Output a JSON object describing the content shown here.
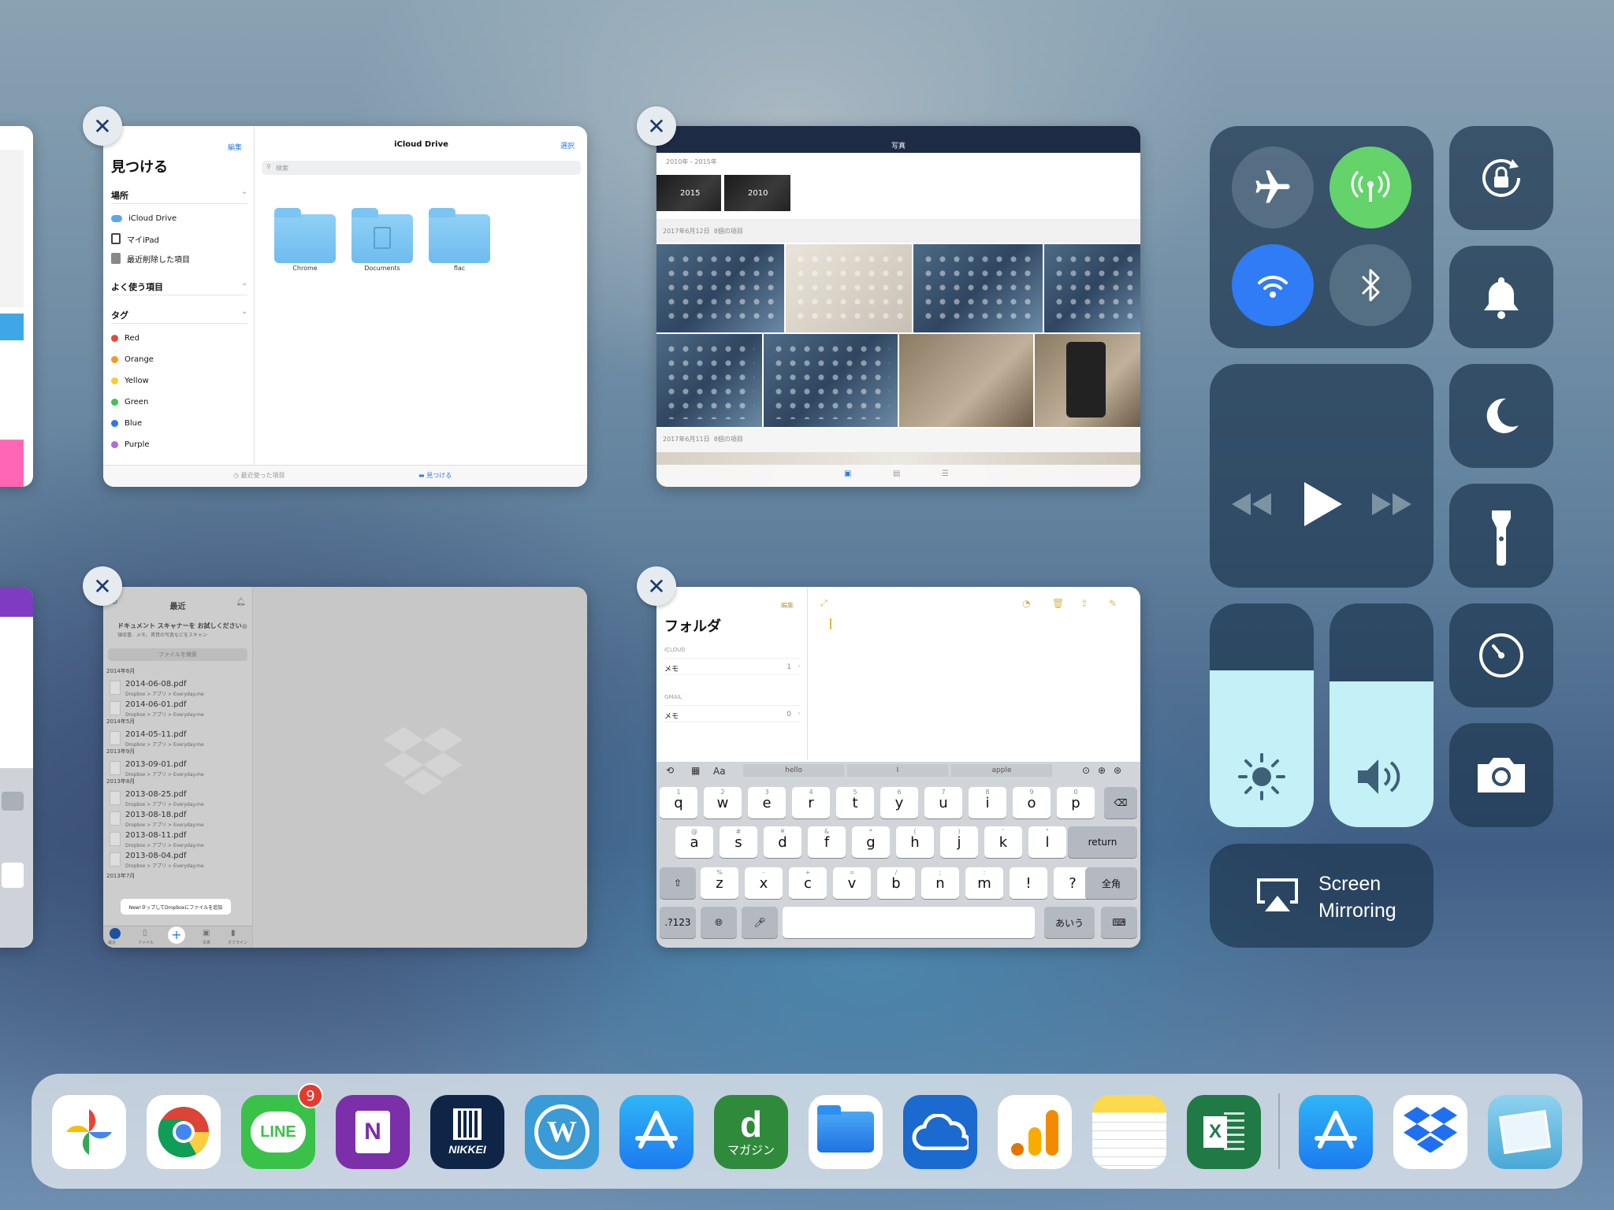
{
  "files_card": {
    "edit": "編集",
    "title": "見つける",
    "locations_header": "場所",
    "locations": [
      "iCloud Drive",
      "マイiPad",
      "最近削除した項目"
    ],
    "favorites_header": "よく使う項目",
    "tags_header": "タグ",
    "tags": [
      {
        "label": "Red",
        "color": "#e5463c"
      },
      {
        "label": "Orange",
        "color": "#f39a25"
      },
      {
        "label": "Yellow",
        "color": "#f7cd2f"
      },
      {
        "label": "Green",
        "color": "#46bf57"
      },
      {
        "label": "Blue",
        "color": "#2f7ae5"
      },
      {
        "label": "Purple",
        "color": "#b46ad9"
      }
    ],
    "main_title": "iCloud Drive",
    "select": "選択",
    "search_placeholder": "検索",
    "folders": [
      "Chrome",
      "Documents",
      "flac"
    ],
    "tab_recent": "最近使った項目",
    "tab_browse": "見つける"
  },
  "photos_card": {
    "title": "写真",
    "range": "2010年 - 2015年",
    "years": [
      "2015",
      "2010"
    ],
    "section1": "2017年6月12日",
    "section1_count": "8個の項目",
    "section2": "2017年6月11日",
    "section2_count": "8個の項目"
  },
  "dropbox_card": {
    "title": "最近",
    "banner_title": "ドキュメント スキャナーを お試しください",
    "banner_sub": "領収書、メモ、賃貸の写真などをスキャン",
    "search_placeholder": "ファイルを検索",
    "sections": [
      {
        "header": "2014年6月",
        "files": [
          "2014-06-08.pdf",
          "2014-06-01.pdf"
        ]
      },
      {
        "header": "2014年5月",
        "files": [
          "2014-05-11.pdf"
        ]
      },
      {
        "header": "2013年9月",
        "files": [
          "2013-09-01.pdf"
        ]
      },
      {
        "header": "2013年8月",
        "files": [
          "2013-08-25.pdf",
          "2013-08-18.pdf",
          "2013-08-11.pdf",
          "2013-08-04.pdf"
        ]
      }
    ],
    "file_sub": "Dropbox > アプリ > Everyday.me",
    "last_header": "2013年7月",
    "tooltip": "New!タップしてDropboxにファイルを追加",
    "tabs": [
      "最近",
      "ファイル",
      "写真",
      "オフライン"
    ]
  },
  "notes_card": {
    "edit": "編集",
    "title": "フォルダ",
    "icloud_header": "ICLOUD",
    "icloud_item": "メモ",
    "icloud_count": "1",
    "gmail_header": "GMAIL",
    "gmail_item": "メモ",
    "gmail_count": "0",
    "suggestions": [
      "hello",
      "I",
      "apple"
    ],
    "format_label": "Aa",
    "row1": [
      [
        "q",
        "1"
      ],
      [
        "w",
        "2"
      ],
      [
        "e",
        "3"
      ],
      [
        "r",
        "4"
      ],
      [
        "t",
        "5"
      ],
      [
        "y",
        "6"
      ],
      [
        "u",
        "7"
      ],
      [
        "i",
        "8"
      ],
      [
        "o",
        "9"
      ],
      [
        "p",
        "0"
      ]
    ],
    "row2": [
      [
        "a",
        "@"
      ],
      [
        "s",
        "#"
      ],
      [
        "d",
        "¥"
      ],
      [
        "f",
        "&"
      ],
      [
        "g",
        "*"
      ],
      [
        "h",
        "("
      ],
      [
        "j",
        ")"
      ],
      [
        "k",
        "'"
      ],
      [
        "l",
        "\""
      ]
    ],
    "row3": [
      [
        "z",
        "%"
      ],
      [
        "x",
        "-"
      ],
      [
        "c",
        "+"
      ],
      [
        "v",
        "="
      ],
      [
        "b",
        "/"
      ],
      [
        "n",
        ";"
      ],
      [
        "m",
        ":"
      ],
      [
        "!",
        ""
      ],
      [
        "?",
        ""
      ]
    ],
    "return_key": "return",
    "zenkaku_key": "全角",
    "numbers_key": ".?123",
    "kana_key": "あいう"
  },
  "control_center": {
    "screen_mirroring": "Screen Mirroring",
    "brightness_level": 0.7,
    "volume_level": 0.65,
    "wifi_on": true,
    "cellular_on": true,
    "bluetooth_on": false,
    "airplane_on": false
  },
  "dock": {
    "apps": [
      {
        "name": "Google Photos",
        "icon": "google-photos-icon"
      },
      {
        "name": "Chrome",
        "icon": "chrome-icon"
      },
      {
        "name": "LINE",
        "icon": "line-icon",
        "label": "LINE",
        "badge": "9"
      },
      {
        "name": "OneNote",
        "icon": "onenote-icon",
        "label": "N"
      },
      {
        "name": "NIKKEI",
        "icon": "nikkei-icon",
        "label": "NIKKEI"
      },
      {
        "name": "WordPress",
        "icon": "wordpress-icon",
        "label": "W"
      },
      {
        "name": "App Store",
        "icon": "app-store-icon"
      },
      {
        "name": "dマガジン",
        "icon": "d-magazine-icon",
        "label": "マガジン"
      },
      {
        "name": "Files",
        "icon": "files-icon"
      },
      {
        "name": "OneDrive",
        "icon": "onedrive-icon"
      },
      {
        "name": "Google Analytics",
        "icon": "analytics-icon"
      },
      {
        "name": "Notes",
        "icon": "notes-icon"
      },
      {
        "name": "Excel",
        "icon": "excel-icon",
        "label": "X"
      },
      {
        "name": "App Store",
        "icon": "app-store-recent-icon"
      },
      {
        "name": "Dropbox",
        "icon": "dropbox-icon"
      },
      {
        "name": "Amazon Photos",
        "icon": "amazon-photos-icon"
      }
    ]
  }
}
